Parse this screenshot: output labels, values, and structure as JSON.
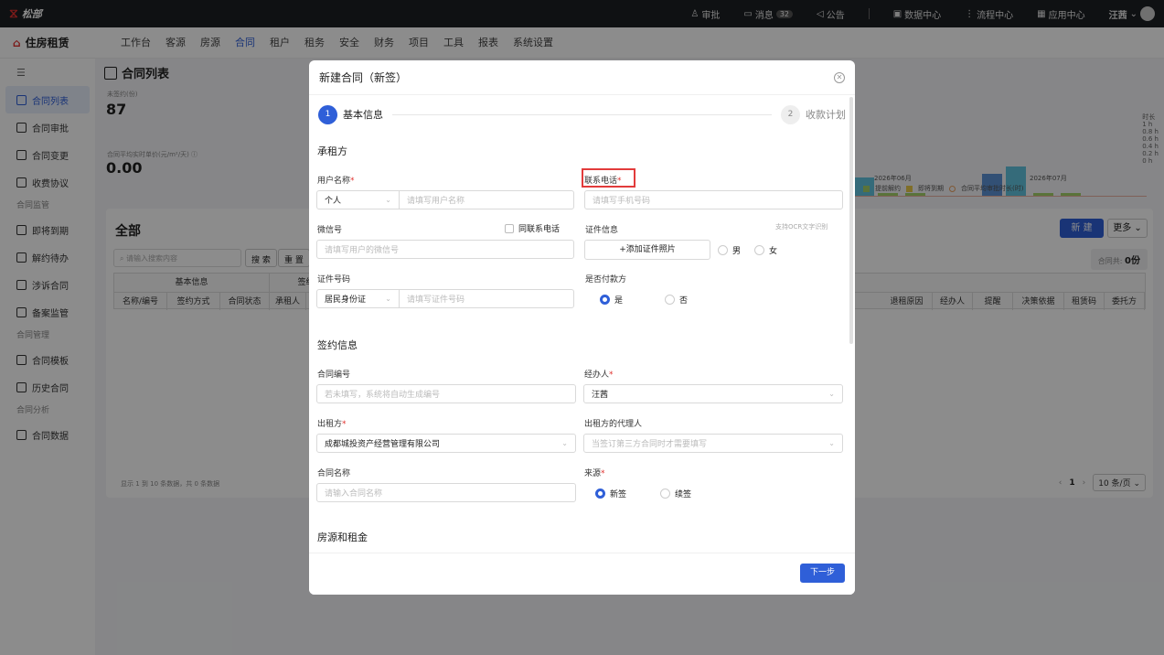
{
  "topbar": {
    "logo": "松部",
    "items": [
      {
        "label": "审批",
        "icon": "user-icon"
      },
      {
        "label": "消息",
        "icon": "message-icon",
        "badge": "32"
      },
      {
        "label": "公告",
        "icon": "megaphone-icon"
      },
      {
        "label": "数据中心",
        "icon": "monitor-icon"
      },
      {
        "label": "流程中心",
        "icon": "flow-icon"
      },
      {
        "label": "应用中心",
        "icon": "grid-icon"
      }
    ],
    "user": "汪茜"
  },
  "nav": {
    "brand": "住房租赁",
    "menu": [
      "工作台",
      "客源",
      "房源",
      "合同",
      "租户",
      "租务",
      "安全",
      "财务",
      "项目",
      "工具",
      "报表",
      "系统设置"
    ],
    "active": "合同"
  },
  "sidebar": {
    "items": [
      {
        "label": "合同列表",
        "type": "item",
        "active": true
      },
      {
        "label": "合同审批",
        "type": "item"
      },
      {
        "label": "合同变更",
        "type": "item"
      },
      {
        "label": "收费协议",
        "type": "item"
      },
      {
        "label": "合同监管",
        "type": "group"
      },
      {
        "label": "即将到期",
        "type": "item"
      },
      {
        "label": "解约待办",
        "type": "item"
      },
      {
        "label": "涉诉合同",
        "type": "item"
      },
      {
        "label": "备案监管",
        "type": "item"
      },
      {
        "label": "合同管理",
        "type": "group"
      },
      {
        "label": "合同模板",
        "type": "item"
      },
      {
        "label": "历史合同",
        "type": "item"
      },
      {
        "label": "合同分析",
        "type": "group"
      },
      {
        "label": "合同数据",
        "type": "item"
      }
    ]
  },
  "page": {
    "title": "合同列表",
    "stat1_label": "未签约(份)",
    "stat1_value": "87",
    "stat2_label": "合同平均实时单价(元/m²/天) ⓘ",
    "stat2_value": "0.00",
    "chart_axis": [
      "时长",
      "1 h",
      "0.8 h",
      "0.6 h",
      "0.4 h",
      "0.2 h",
      "0 h"
    ],
    "chart_months": [
      "2026年06月",
      "2026年07月"
    ],
    "chart_legend": [
      "提前解约",
      "即将到期",
      "合同平均审批时长(时)"
    ],
    "list_title": "全部",
    "search_placeholder": "请输入搜索内容",
    "btn_search": "搜 索",
    "btn_reset": "重 置",
    "btn_new": "新 建",
    "btn_more": "更多",
    "total_label": "合同共:",
    "total_value": "0份",
    "table_group_headers": [
      "基本信息",
      "签约"
    ],
    "table_headers_left": [
      "名称/编号",
      "签约方式",
      "合同状态",
      "承租人"
    ],
    "table_headers_right": [
      "退租原因",
      "经办人",
      "提醒",
      "决策依据",
      "租赁码",
      "委托方"
    ],
    "pager_info": "显示 1 到 10 条数据，共 0 条数据",
    "pager_page": "1",
    "pager_size": "10 条/页"
  },
  "modal": {
    "title": "新建合同（新签）",
    "steps": [
      {
        "num": "1",
        "label": "基本信息"
      },
      {
        "num": "2",
        "label": "收款计划"
      }
    ],
    "section_lessee": "承租方",
    "user_name_label": "用户名称",
    "user_type": "个人",
    "user_name_placeholder": "请填写用户名称",
    "phone_label": "联系电话",
    "phone_placeholder": "请填写手机号码",
    "wechat_label": "微信号",
    "same_phone_label": "同联系电话",
    "wechat_placeholder": "请填写用户的微信号",
    "cert_label": "证件信息",
    "ocr_hint": "支持OCR文字识别",
    "add_cert": "+添加证件照片",
    "gender_male": "男",
    "gender_female": "女",
    "id_label": "证件号码",
    "id_type": "居民身份证",
    "id_placeholder": "请填写证件号码",
    "payer_label": "是否付款方",
    "yes": "是",
    "no": "否",
    "section_sign": "签约信息",
    "contract_no_label": "合同编号",
    "contract_no_placeholder": "若未填写，系统将自动生成编号",
    "agent_label": "经办人",
    "agent_value": "汪茜",
    "lessor_label": "出租方",
    "lessor_value": "成都城投资产经营管理有限公司",
    "lessor_agent_label": "出租方的代理人",
    "lessor_agent_placeholder": "当签订第三方合同时才需要填写",
    "contract_name_label": "合同名称",
    "contract_name_placeholder": "请输入合同名称",
    "source_label": "来源",
    "source_new": "新签",
    "source_renew": "续签",
    "section_house": "房源和租金",
    "btn_next": "下一步"
  },
  "colors": {
    "primary": "#2f5fd8",
    "required": "#e0312e",
    "highlight": "#e23b3b"
  }
}
